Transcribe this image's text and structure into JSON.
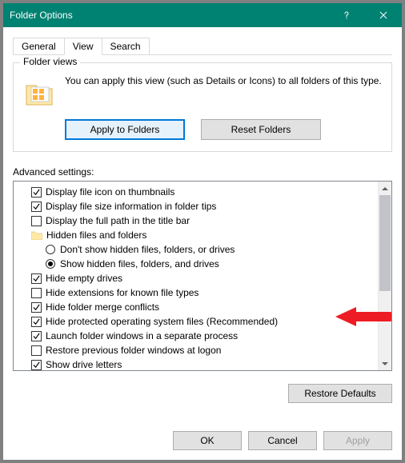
{
  "window": {
    "title": "Folder Options"
  },
  "tabs": [
    "General",
    "View",
    "Search"
  ],
  "active_tab": 1,
  "folder_views": {
    "legend": "Folder views",
    "text": "You can apply this view (such as Details or Icons) to all folders of this type.",
    "apply_btn": "Apply to Folders",
    "reset_btn": "Reset Folders"
  },
  "advanced_label": "Advanced settings:",
  "settings": [
    {
      "type": "check",
      "checked": true,
      "indent": 1,
      "label": "Display file icon on thumbnails"
    },
    {
      "type": "check",
      "checked": true,
      "indent": 1,
      "label": "Display file size information in folder tips"
    },
    {
      "type": "check",
      "checked": false,
      "indent": 1,
      "label": "Display the full path in the title bar"
    },
    {
      "type": "group",
      "indent": 1,
      "label": "Hidden files and folders"
    },
    {
      "type": "radio",
      "checked": false,
      "indent": 2,
      "label": "Don't show hidden files, folders, or drives"
    },
    {
      "type": "radio",
      "checked": true,
      "indent": 2,
      "label": "Show hidden files, folders, and drives"
    },
    {
      "type": "check",
      "checked": true,
      "indent": 1,
      "label": "Hide empty drives"
    },
    {
      "type": "check",
      "checked": false,
      "indent": 1,
      "label": "Hide extensions for known file types"
    },
    {
      "type": "check",
      "checked": true,
      "indent": 1,
      "label": "Hide folder merge conflicts"
    },
    {
      "type": "check",
      "checked": true,
      "indent": 1,
      "label": "Hide protected operating system files (Recommended)"
    },
    {
      "type": "check",
      "checked": true,
      "indent": 1,
      "label": "Launch folder windows in a separate process"
    },
    {
      "type": "check",
      "checked": false,
      "indent": 1,
      "label": "Restore previous folder windows at logon"
    },
    {
      "type": "check",
      "checked": true,
      "indent": 1,
      "label": "Show drive letters"
    }
  ],
  "restore_defaults": "Restore Defaults",
  "buttons": {
    "ok": "OK",
    "cancel": "Cancel",
    "apply": "Apply"
  },
  "arrow_color": "#ed1c24"
}
